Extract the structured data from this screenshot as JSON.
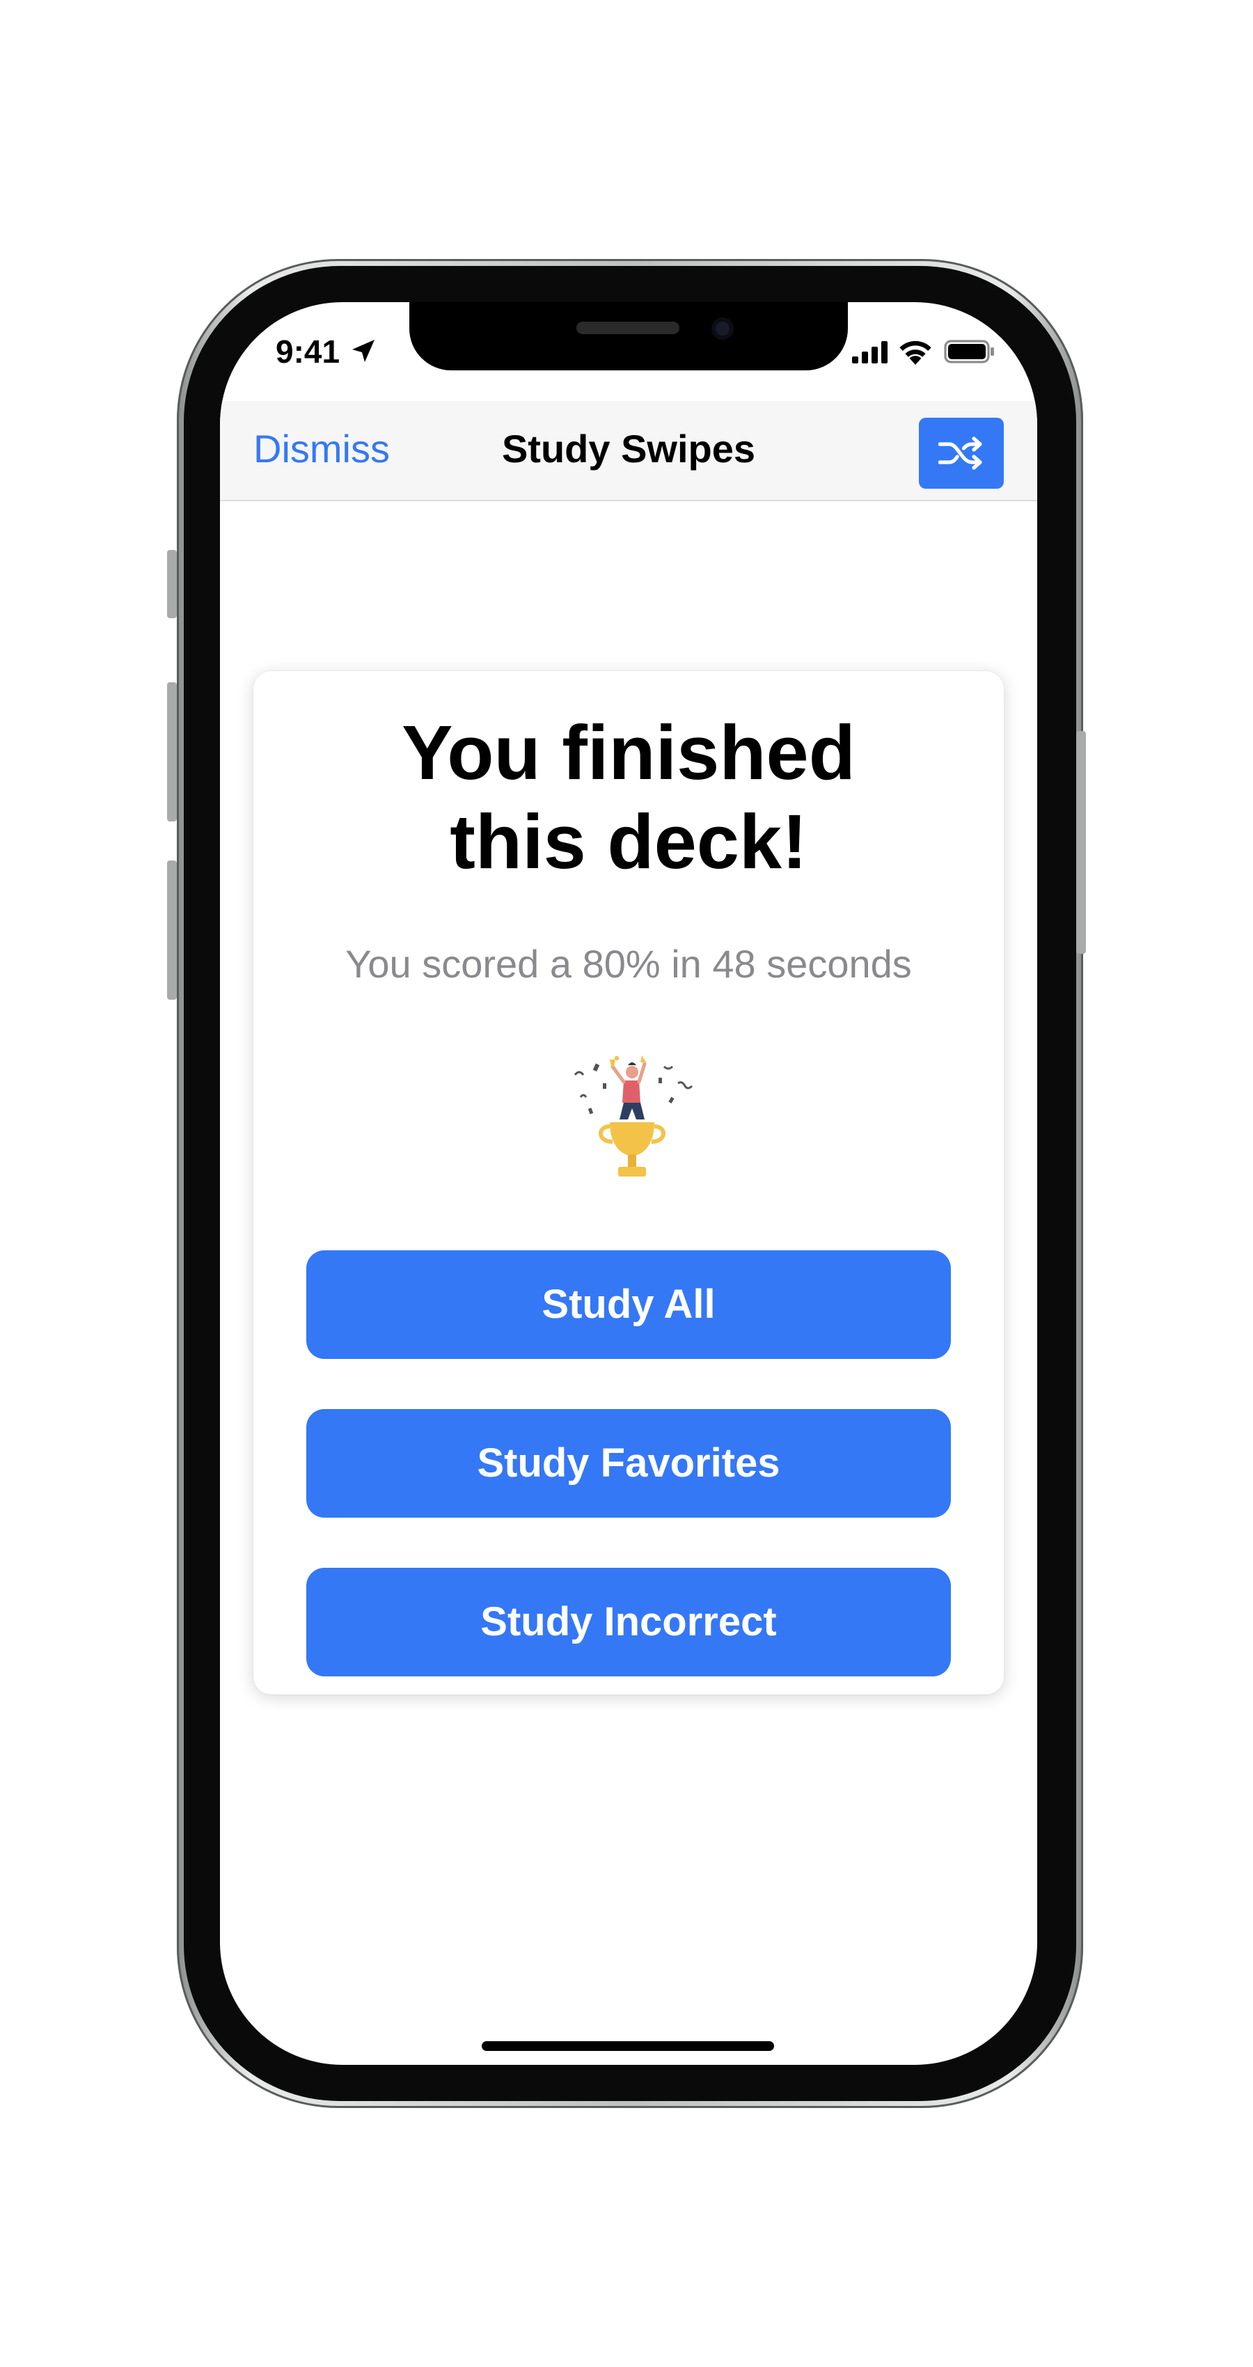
{
  "status_bar": {
    "time": "9:41"
  },
  "nav": {
    "dismiss_label": "Dismiss",
    "title": "Study Swipes",
    "shuffle_icon": "shuffle-icon"
  },
  "card": {
    "headline_line1": "You finished",
    "headline_line2": "this deck!",
    "score_text": "You scored a 80% in 48 seconds",
    "buttons": [
      {
        "label": "Study All"
      },
      {
        "label": "Study Favorites"
      },
      {
        "label": "Study Incorrect"
      }
    ]
  },
  "colors": {
    "accent": "#3478f6",
    "secondary_text": "#8a8a8e",
    "nav_background": "#f6f6f6",
    "trophy": "#f3c349"
  }
}
